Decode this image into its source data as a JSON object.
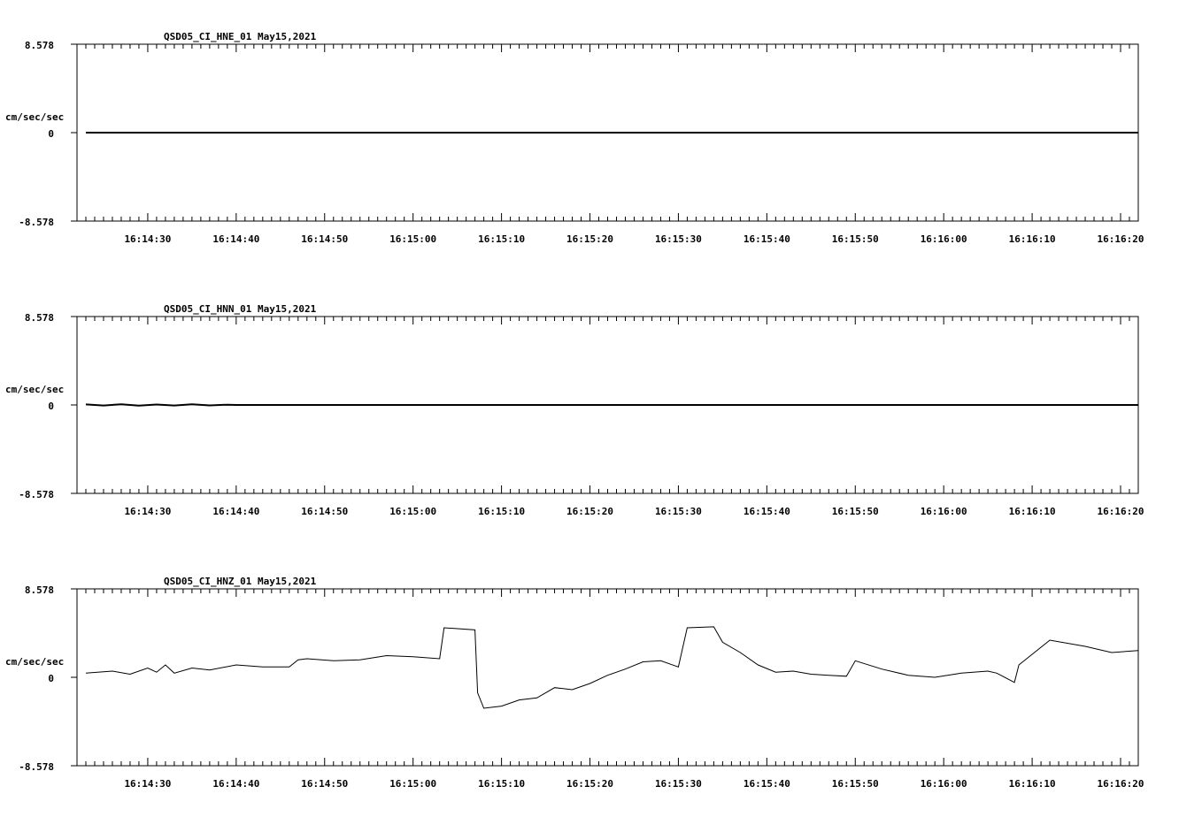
{
  "colors": {
    "background": "#ffffff",
    "ink": "#000000"
  },
  "chart_data": [
    {
      "type": "line",
      "title": "QSD05_CI_HNE_01  May15,2021",
      "ylabel": "cm/sec/sec",
      "ylim": [
        -8.578,
        8.578
      ],
      "ytick_labels": [
        "8.578",
        "0",
        "-8.578"
      ],
      "x_range": [
        "16:14:22",
        "16:16:22"
      ],
      "x_tick_labels": [
        "16:14:30",
        "16:14:40",
        "16:14:50",
        "16:15:00",
        "16:15:10",
        "16:15:20",
        "16:15:30",
        "16:15:40",
        "16:15:50",
        "16:16:00",
        "16:16:10",
        "16:16:20"
      ],
      "grid": false,
      "series": [
        {
          "x": [
            "16:14:23",
            "16:16:22"
          ],
          "values": [
            0.0,
            0.0
          ]
        }
      ]
    },
    {
      "type": "line",
      "title": "QSD05_CI_HNN_01  May15,2021",
      "ylabel": "cm/sec/sec",
      "ylim": [
        -8.578,
        8.578
      ],
      "ytick_labels": [
        "8.578",
        "0",
        "-8.578"
      ],
      "x_range": [
        "16:14:22",
        "16:16:22"
      ],
      "x_tick_labels": [
        "16:14:30",
        "16:14:40",
        "16:14:50",
        "16:15:00",
        "16:15:10",
        "16:15:20",
        "16:15:30",
        "16:15:40",
        "16:15:50",
        "16:16:00",
        "16:16:10",
        "16:16:20"
      ],
      "grid": false,
      "series": [
        {
          "x": [
            "16:14:23",
            "16:14:25",
            "16:14:27",
            "16:14:29",
            "16:14:31",
            "16:14:33",
            "16:14:35",
            "16:14:37",
            "16:14:39",
            "16:14:40",
            "16:16:22"
          ],
          "values": [
            0.05,
            -0.05,
            0.07,
            -0.06,
            0.04,
            -0.05,
            0.06,
            -0.04,
            0.03,
            0.0,
            0.0
          ]
        }
      ]
    },
    {
      "type": "line",
      "title": "QSD05_CI_HNZ_01  May15,2021",
      "ylabel": "cm/sec/sec",
      "ylim": [
        -8.578,
        8.578
      ],
      "ytick_labels": [
        "8.578",
        "0",
        "-8.578"
      ],
      "x_range": [
        "16:14:22",
        "16:16:22"
      ],
      "x_tick_labels": [
        "16:14:30",
        "16:14:40",
        "16:14:50",
        "16:15:00",
        "16:15:10",
        "16:15:20",
        "16:15:30",
        "16:15:40",
        "16:15:50",
        "16:16:00",
        "16:16:10",
        "16:16:20"
      ],
      "grid": false,
      "series": [
        {
          "x": [
            "16:14:23",
            "16:14:26",
            "16:14:28",
            "16:14:30",
            "16:14:31",
            "16:14:32",
            "16:14:33",
            "16:14:35",
            "16:14:37",
            "16:14:40",
            "16:14:43",
            "16:14:46",
            "16:14:47",
            "16:14:48",
            "16:14:51",
            "16:14:54",
            "16:14:57",
            "16:15:00",
            "16:15:03",
            "16:15:03.5",
            "16:15:07",
            "16:15:07.3",
            "16:15:08",
            "16:15:10",
            "16:15:12",
            "16:15:14",
            "16:15:16",
            "16:15:18",
            "16:15:20",
            "16:15:22",
            "16:15:24",
            "16:15:26",
            "16:15:28",
            "16:15:30",
            "16:15:31",
            "16:15:34",
            "16:15:35",
            "16:15:37",
            "16:15:39",
            "16:15:41",
            "16:15:43",
            "16:15:45",
            "16:15:47",
            "16:15:49",
            "16:15:50",
            "16:15:53",
            "16:15:56",
            "16:15:59",
            "16:16:02",
            "16:16:05",
            "16:16:06",
            "16:16:08",
            "16:16:08.5",
            "16:16:12",
            "16:16:16",
            "16:16:19",
            "16:16:22"
          ],
          "values": [
            0.4,
            0.6,
            0.3,
            0.9,
            0.5,
            1.2,
            0.4,
            0.9,
            0.7,
            1.2,
            1.0,
            1.0,
            1.7,
            1.8,
            1.6,
            1.7,
            2.1,
            2.0,
            1.8,
            4.8,
            4.6,
            -1.5,
            -3.0,
            -2.8,
            -2.2,
            -2.0,
            -1.0,
            -1.2,
            -0.6,
            0.2,
            0.8,
            1.5,
            1.6,
            1.0,
            4.8,
            4.9,
            3.4,
            2.4,
            1.2,
            0.5,
            0.6,
            0.3,
            0.2,
            0.1,
            1.6,
            0.8,
            0.2,
            0.0,
            0.4,
            0.6,
            0.4,
            -0.5,
            1.2,
            3.6,
            3.0,
            2.4,
            2.6
          ]
        }
      ]
    }
  ]
}
